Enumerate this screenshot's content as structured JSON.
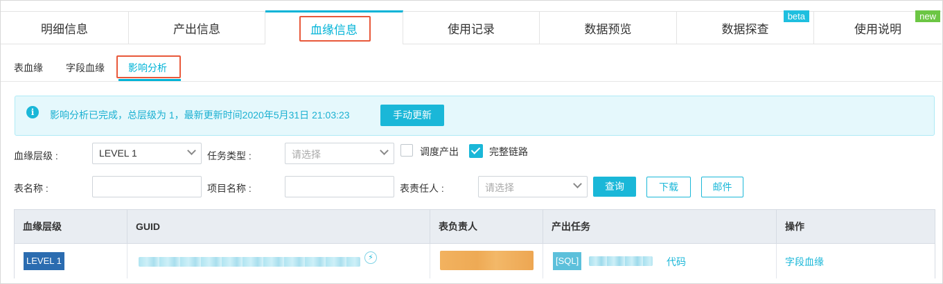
{
  "top_tabs": [
    {
      "label": "明细信息"
    },
    {
      "label": "产出信息"
    },
    {
      "label": "血缘信息"
    },
    {
      "label": "使用记录"
    },
    {
      "label": "数据预览"
    },
    {
      "label": "数据探查",
      "badge": "beta"
    },
    {
      "label": "使用说明",
      "badge": "new"
    }
  ],
  "sub_tabs": [
    {
      "label": "表血缘"
    },
    {
      "label": "字段血缘"
    },
    {
      "label": "影响分析"
    }
  ],
  "alert": {
    "text": "影响分析已完成，总层级为 1，最新更新时间2020年5月31日 21:03:23",
    "button": "手动更新"
  },
  "filters": {
    "lineage_level_label": "血缘层级 :",
    "lineage_level_value": "LEVEL 1",
    "task_type_label": "任务类型 :",
    "task_type_placeholder": "请选择",
    "scheduled_output_label": "调度产出",
    "full_chain_label": "完整链路",
    "table_name_label": "表名称 :",
    "project_name_label": "项目名称 :",
    "owner_label": "表责任人 :",
    "owner_placeholder": "请选择",
    "query_button": "查询",
    "download_button": "下载",
    "mail_button": "邮件"
  },
  "table": {
    "headers": [
      "血缘层级",
      "GUID",
      "表负责人",
      "产出任务",
      "操作"
    ],
    "rows": [
      {
        "level": "LEVEL 1",
        "task_type": "[SQL]",
        "code_link": "代码",
        "action": "字段血缘"
      }
    ]
  },
  "colors": {
    "accent": "#1ab7d8",
    "highlight": "#e8583a",
    "level_tag": "#2b6cb0"
  }
}
